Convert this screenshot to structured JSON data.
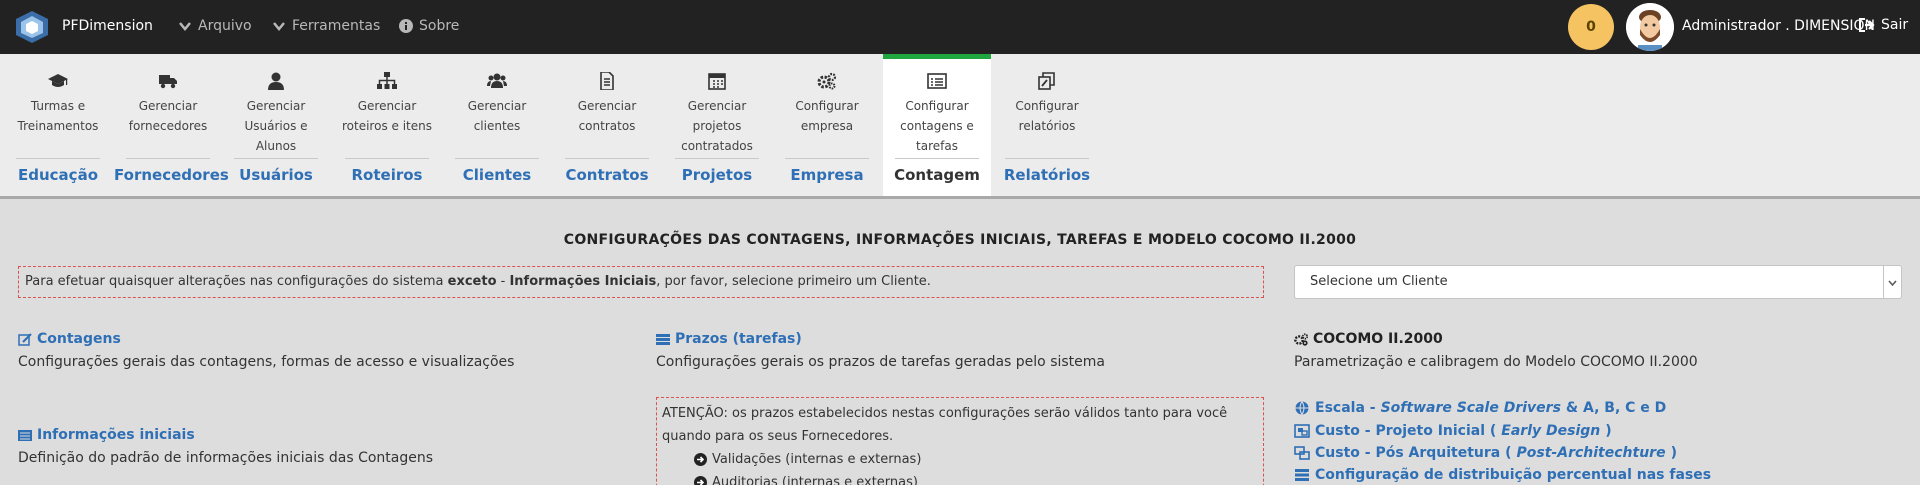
{
  "colors": {
    "topbar": "#222222",
    "accent_blue": "#2f6fb5",
    "active_tab_border": "#1fa63f",
    "badge": "#f5c361",
    "dashed_border": "#d9534f"
  },
  "topbar": {
    "brand": "PFDimension",
    "menu": [
      {
        "label": "Arquivo",
        "icon": "chevron-down-icon"
      },
      {
        "label": "Ferramentas",
        "icon": "chevron-down-icon"
      },
      {
        "label": "Sobre",
        "icon": "info-circle-icon"
      }
    ],
    "notification_count": "0",
    "user": "Administrador . DIMENSION",
    "logout": "Sair"
  },
  "modules": [
    {
      "label": "Turmas e Treinamentos",
      "category": "Educação",
      "icon": "graduation-cap-icon"
    },
    {
      "label": "Gerenciar fornecedores",
      "category": "Fornecedores",
      "icon": "truck-icon"
    },
    {
      "label": "Gerenciar Usuários e Alunos",
      "category": "Usuários",
      "icon": "user-icon"
    },
    {
      "label": "Gerenciar roteiros e itens",
      "category": "Roteiros",
      "icon": "sitemap-icon"
    },
    {
      "label": "Gerenciar clientes",
      "category": "Clientes",
      "icon": "users-icon"
    },
    {
      "label": "Gerenciar contratos",
      "category": "Contratos",
      "icon": "file-text-icon"
    },
    {
      "label": "Gerenciar projetos contratados",
      "category": "Projetos",
      "icon": "calendar-icon"
    },
    {
      "label": "Configurar empresa",
      "category": "Empresa",
      "icon": "cogs-icon"
    },
    {
      "label": "Configurar contagens e tarefas",
      "category": "Contagem",
      "icon": "list-alt-icon",
      "active": true
    },
    {
      "label": "Configurar relatórios",
      "category": "Relatórios",
      "icon": "copy-edit-icon"
    }
  ],
  "page": {
    "title": "CONFIGURAÇÕES DAS CONTAGENS, INFORMAÇÕES INICIAIS, TAREFAS E MODELO COCOMO II.2000",
    "notice": {
      "pre": "Para efetuar quaisquer alterações nas configurações do sistema ",
      "bold1": "exceto",
      "mid": " - ",
      "bold2": "Informações Iniciais",
      "post": ", por favor, selecione primeiro um Cliente."
    },
    "client_select": "Selecione um Cliente",
    "sections": {
      "contagens": {
        "title": "Contagens",
        "desc": "Configurações gerais das contagens, formas de acesso e visualizações"
      },
      "prazos": {
        "title": "Prazos (tarefas)",
        "desc": "Configurações gerais os prazos de tarefas geradas pelo sistema"
      },
      "cocomo": {
        "title": "COCOMO II.2000",
        "desc": "Parametrização e calibragem do Modelo COCOMO II.2000"
      },
      "informacoes": {
        "title": "Informações iniciais",
        "desc": "Definição do padrão de informações iniciais das Contagens"
      }
    },
    "warning": {
      "text": "ATENÇÃO: os prazos estabelecidos nestas configurações serão válidos tanto para você quando para os seus Fornecedores.",
      "items": [
        "Validações (internas e externas)",
        "Auditorias (internas e externas)"
      ]
    },
    "cocomo_links": {
      "escala": {
        "pre": "Escala - ",
        "italic": "Software Scale Drivers",
        "post": " & A, B, C e D"
      },
      "custo_inicial": {
        "pre": "Custo - Projeto Inicial (",
        "italic": "Early Design",
        "post": ")"
      },
      "custo_pos": {
        "pre": "Custo - Pós Arquitetura (",
        "italic": "Post-Architechture",
        "post": ")"
      },
      "distribuicao": {
        "pre": "Configuração de distribuição percentual nas fases"
      }
    }
  }
}
